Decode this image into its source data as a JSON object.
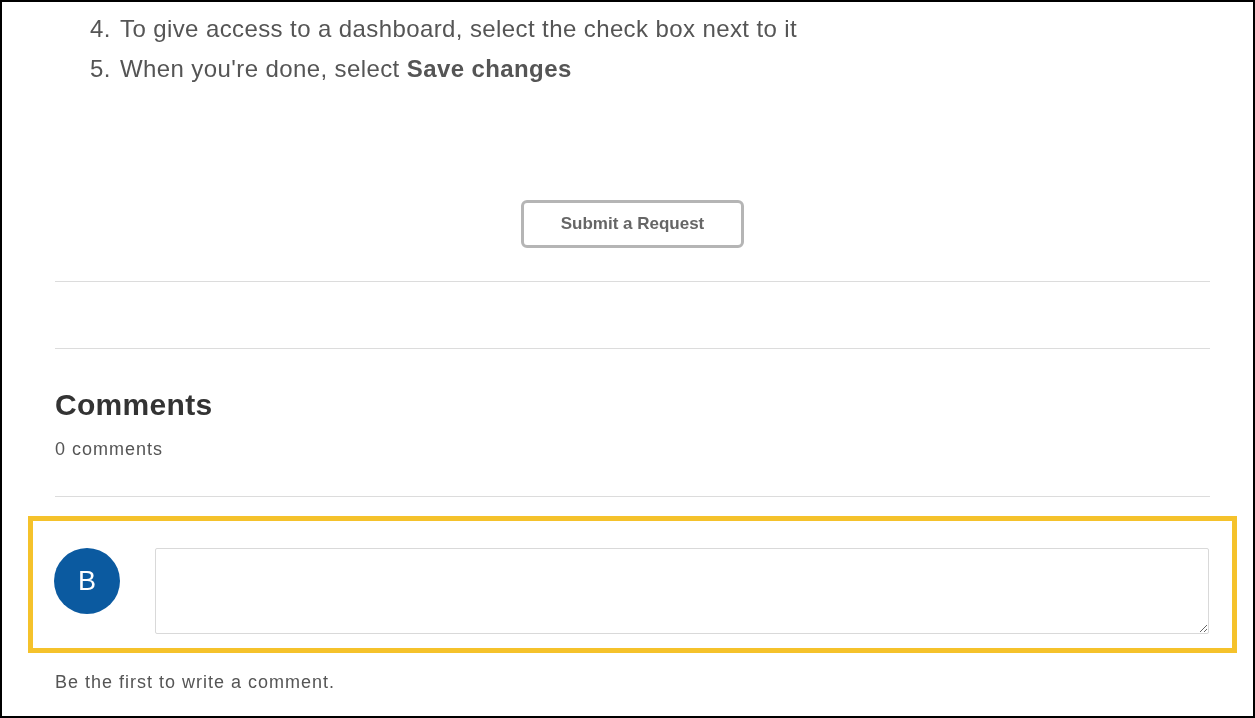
{
  "steps": [
    {
      "number": "4.",
      "text": "To give access to a dashboard, select the check box next to it"
    },
    {
      "number": "5.",
      "text": "When you're done, select **Save changes**"
    }
  ],
  "submit_button": {
    "label": "Submit a Request"
  },
  "comments": {
    "title": "Comments",
    "count": "0 comments"
  },
  "comment_form": {
    "highlighted": true,
    "avatar": {
      "initial": "B"
    }
  },
  "empty_message": "Be the first to write a comment."
}
